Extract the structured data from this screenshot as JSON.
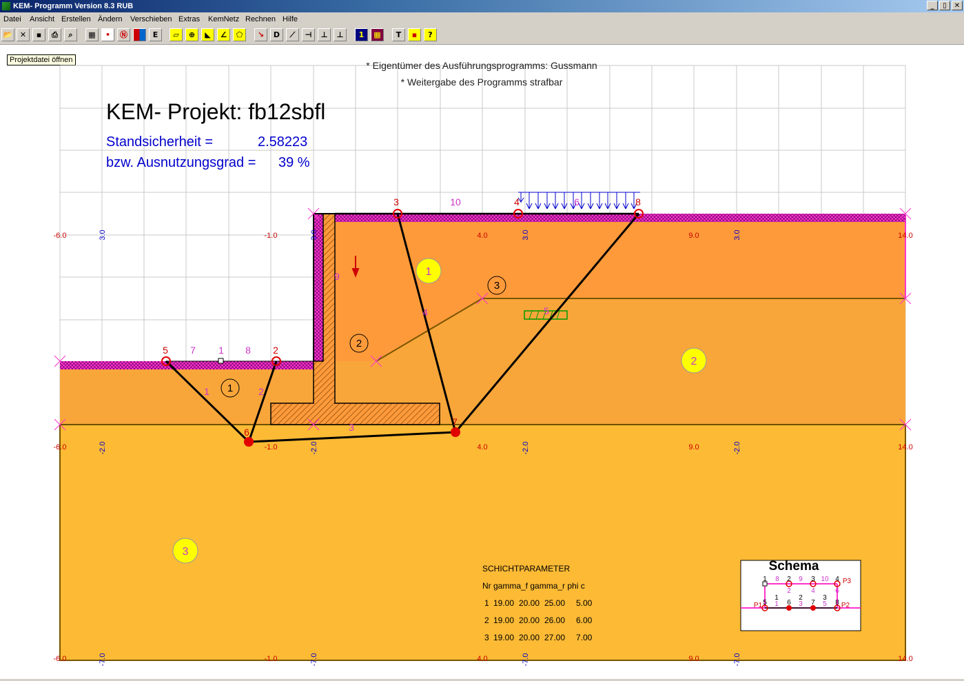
{
  "window": {
    "title": "KEM- Programm Version 8.3 RUB",
    "buttons": [
      "_",
      "▯",
      "✕"
    ]
  },
  "menu": [
    "Datei",
    "Ansicht",
    "Erstellen",
    "Ändern",
    "Verschieben",
    "Extras",
    "KemNetz",
    "Rechnen",
    "Hilfe"
  ],
  "toolbar": {
    "icons": [
      "open-icon",
      "close-doc-icon",
      "save-icon",
      "print-icon",
      "preview-icon",
      "grid-icon",
      "point-icon",
      "node-icon",
      "color-icon",
      "edit-icon",
      "layer-icon",
      "zoom-icon",
      "soil-icon",
      "angle-icon",
      "polygon-icon",
      "force-icon",
      "dim-icon",
      "line-icon",
      "wall-icon",
      "anchor-icon",
      "support-icon",
      "number-icon",
      "matrix-icon",
      "text-icon",
      "legend-icon",
      "help-icon"
    ],
    "labels": {
      "edit": "E",
      "number": "1",
      "text": "T"
    }
  },
  "tooltip": "Projektdatei öffnen",
  "header": {
    "owner": "* Eigentümer des Ausführungsprogramms: Gussmann",
    "warning": "* Weitergabe des Programms strafbar"
  },
  "project": {
    "title": "KEM- Projekt: fb12sbfl",
    "safety_label": "Standsicherheit =",
    "safety_value": "2.58223",
    "util_label": "bzw. Ausnutzungsgrad =",
    "util_value": "39 %"
  },
  "axis_labels": {
    "x_red": [
      "-6.0",
      "-1.0",
      "4.0",
      "9.0",
      "14.0"
    ],
    "z_blue_top": [
      "3.0",
      "3.0",
      "3.0",
      "3.0",
      "3.0"
    ],
    "z_blue_mid": [
      "-2.0",
      "-2.0",
      "-2.0",
      "-2.0"
    ],
    "z_blue_bot": [
      "-7.0",
      "-7.0",
      "-7.0",
      "-7.0"
    ]
  },
  "nodes": [
    "1",
    "2",
    "3",
    "4",
    "5",
    "6",
    "7",
    "8"
  ],
  "node_labels": {
    "n5": "5",
    "n2": "2",
    "n3": "3",
    "n4": "4",
    "n8": "8",
    "n6": "6",
    "n7": "7"
  },
  "line_labels": {
    "l7": "7",
    "l1": "1",
    "l8": "8",
    "l10": "10",
    "l1b": "1",
    "l2": "2",
    "l3": "3",
    "l4": "4",
    "l6": "6",
    "l9": "9",
    "l5": "5"
  },
  "soil_labels": {
    "s1": "1",
    "s2": "2",
    "s3": "3"
  },
  "block_labels": {
    "b1": "1",
    "b2": "2",
    "b3": "3"
  },
  "layers": {
    "title": "SCHICHTPARAMETER",
    "header": "Nr gamma_f gamma_r phi c",
    "rows": [
      [
        "1",
        "19.00",
        "20.00",
        "25.00",
        "5.00"
      ],
      [
        "2",
        "19.00",
        "20.00",
        "26.00",
        "6.00"
      ],
      [
        "3",
        "19.00",
        "20.00",
        "27.00",
        "7.00"
      ]
    ]
  },
  "schema": {
    "title": "Schema",
    "top_nodes": [
      "1",
      "2",
      "3",
      "4"
    ],
    "top_lines": [
      "8",
      "9",
      "10"
    ],
    "mid_lines": [
      "2",
      "4",
      "6"
    ],
    "blocks": [
      "1",
      "2",
      "3"
    ],
    "bottom": [
      "5",
      "6",
      "7",
      "8"
    ],
    "bottom_lines": [
      "1",
      "3",
      "5"
    ],
    "p_labels": [
      "P3",
      "P1",
      "P2"
    ]
  },
  "colors": {
    "soil_top": "#ff9a3a",
    "soil_mid": "#f8a63a",
    "soil_bottom": "#fcba35",
    "magenta": "#ff33cc",
    "grid": "#c8c8c8",
    "axis_red": "#cc0000",
    "axis_blue": "#0000cc"
  }
}
